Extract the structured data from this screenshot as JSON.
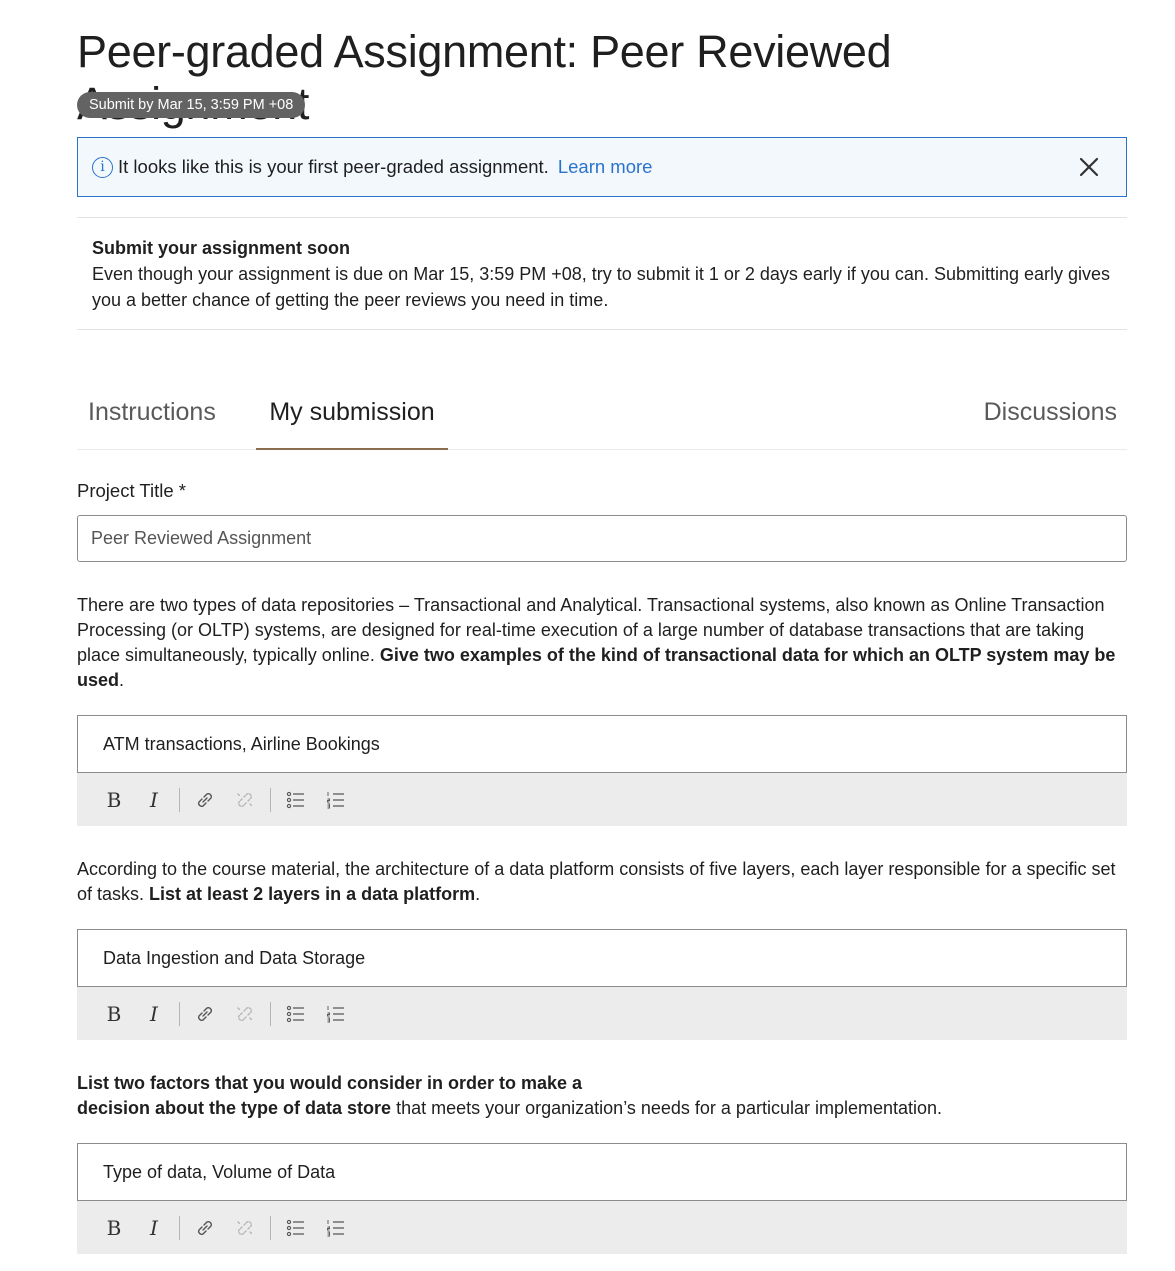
{
  "header": {
    "title": "Peer-graded Assignment: Peer Reviewed Assignment",
    "deadline_badge": "Submit by Mar 15, 3:59 PM +08"
  },
  "info_banner": {
    "icon": "info-icon",
    "text": "It looks like this is your first peer-graded assignment.",
    "link_label": "Learn more",
    "close_icon": "close-icon"
  },
  "notice": {
    "title": "Submit your assignment soon",
    "body": "Even though your assignment is due on Mar 15, 3:59 PM +08, try to submit it 1 or 2 days early if you can. Submitting early gives you a better chance of getting the peer reviews you need in time."
  },
  "tabs": [
    {
      "label": "Instructions",
      "active": false
    },
    {
      "label": "My submission",
      "active": true
    },
    {
      "label": "Discussions",
      "active": false
    }
  ],
  "form": {
    "project_title_label": "Project Title *",
    "project_title_value": "Peer Reviewed Assignment",
    "questions": [
      {
        "text_plain": "There are two types of data repositories – Transactional and Analytical. Transactional systems, also known as Online Transaction Processing (or OLTP) systems, are designed for real-time execution of a large number of database transactions that are taking place simultaneously, typically online.",
        "text_bold": "Give two examples of the kind of transactional data for which an OLTP system may be used",
        "text_suffix": ".",
        "answer": "ATM transactions, Airline Bookings"
      },
      {
        "text_plain": "According to the course material, the architecture of a data platform consists of five layers, each layer responsible for a specific set of tasks.",
        "text_bold": "List at least 2 layers in a data platform",
        "text_suffix": ".",
        "answer": "Data Ingestion and Data Storage"
      },
      {
        "text_bold_1": "List two factors that you would consider in order to make a",
        "text_bold_2": "decision about the type of data store",
        "text_plain": "that meets your organization’s needs for a particular implementation.",
        "answer": "Type of data, Volume of Data"
      }
    ]
  },
  "toolbar": {
    "bold_label": "B",
    "italic_label": "I",
    "icons": [
      "bold-icon",
      "italic-icon",
      "link-icon",
      "unlink-icon",
      "bulleted-list-icon",
      "numbered-list-icon"
    ]
  },
  "colors": {
    "accent_blue": "#2a73cc",
    "badge_gray": "#636363",
    "tab_underline": "#8a6d4f",
    "toolbar_bg": "#ececec"
  }
}
